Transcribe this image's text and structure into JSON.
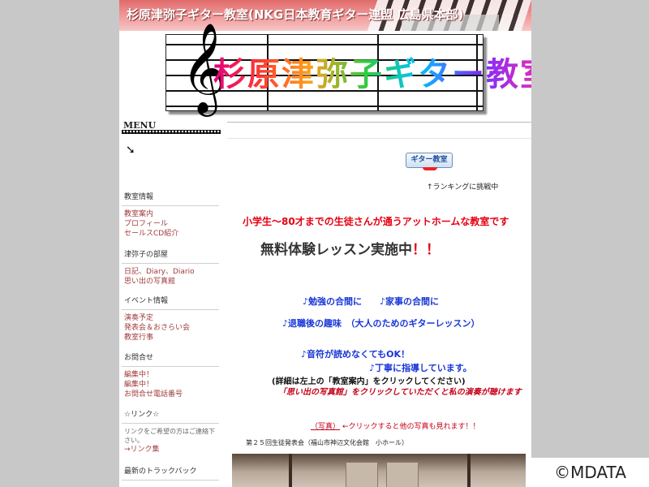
{
  "header": {
    "site_title": "杉原津弥子ギター教室(NKG日本教育ギター連盟 広島県本部)"
  },
  "logo": {
    "text": "杉原津弥子ギター教室",
    "clef": "𝄞"
  },
  "sidebar": {
    "menu_label": "MENU",
    "menu_arrow": "➘",
    "sections": [
      {
        "heading": "教室情報",
        "links": [
          "教室案内",
          "プロフィール",
          "セールスCD紹介"
        ]
      },
      {
        "heading": "津弥子の部屋",
        "links": [
          "日記、Diary、Diario",
          "思い出の写真館"
        ]
      },
      {
        "heading": "イベント情報",
        "links": [
          "演奏予定",
          "発表会＆おさらい会",
          "教室行事"
        ]
      },
      {
        "heading": "お問合せ",
        "links": [
          "編集中！",
          "編集中！",
          "お問合せ電話番号"
        ]
      },
      {
        "heading": "☆リンク☆",
        "note": "リンクをご希望の方はご連絡下さい。",
        "links": [
          "→リンク集"
        ]
      },
      {
        "heading": "最新のトラックバック",
        "links": []
      }
    ]
  },
  "main": {
    "rank_badge": "ギター教室",
    "rank_note": "↑ランキングに挑戦中",
    "intro": "小学生～80才までの生徒さんが通うアットホームな教室です",
    "trial_text": "無料体験レッスン実施中",
    "trial_marks": "！！",
    "lines": [
      "♪勉強の合間に　　♪家事の合間に",
      "♪退職後の趣味　（大人のためのギターレッスン）",
      "♪音符が読めなくてもOK！",
      "♪丁寧に指導しています。"
    ],
    "detail": "(詳細は左上の「教室案内」をクリックしてください)",
    "memory_link": "「思い出の写真館」をクリックしていただくと私の演奏が聴けます",
    "photo_link": "（写真）",
    "photo_note": "←クリックすると他の写真も見れます！！",
    "concert": "第２５回生徒発表会（福山市神辺文化会館　小ホール）"
  },
  "watermark": "©MDATA"
}
